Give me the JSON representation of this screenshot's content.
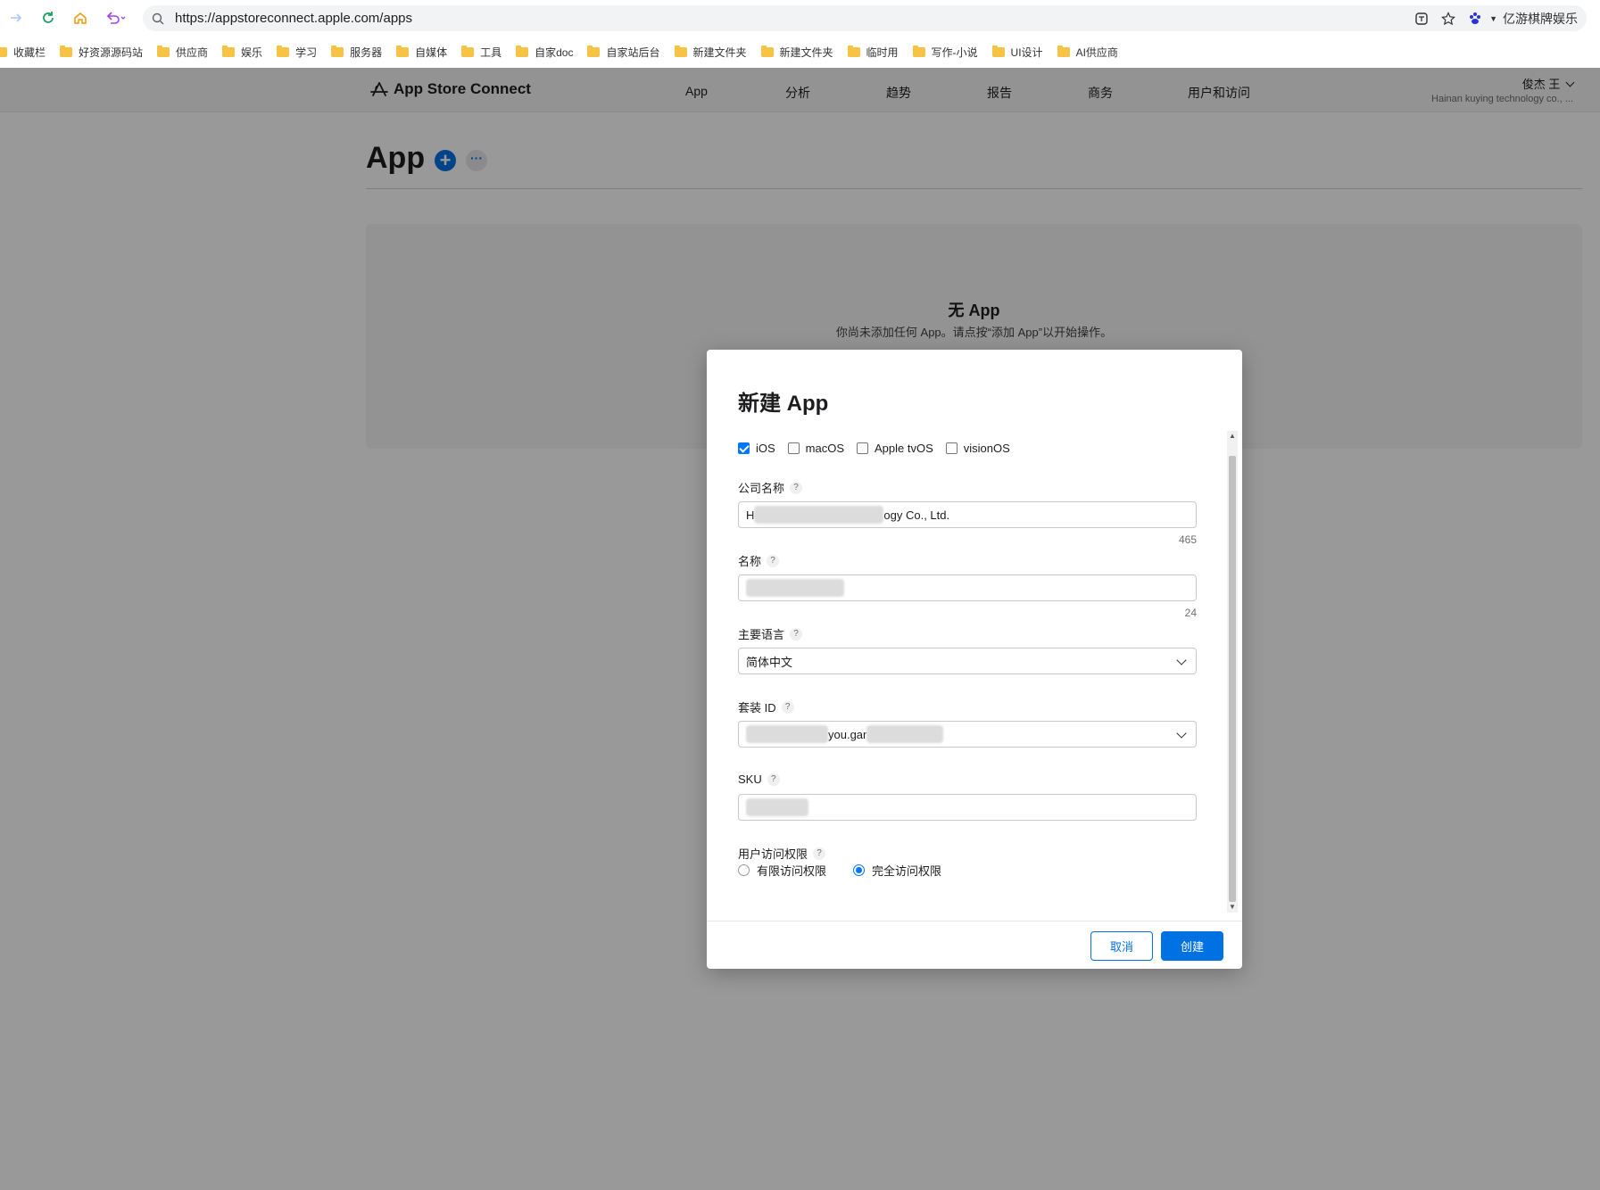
{
  "browser": {
    "url": "https://appstoreconnect.apple.com/apps",
    "profile_name": "亿游棋牌娱乐",
    "bookmarks": [
      "收藏栏",
      "好资源源码站",
      "供应商",
      "娱乐",
      "学习",
      "服务器",
      "自媒体",
      "工具",
      "自家doc",
      "自家站后台",
      "新建文件夹",
      "新建文件夹",
      "临时用",
      "写作-小说",
      "UI设计",
      "AI供应商"
    ]
  },
  "header": {
    "brand": "App Store Connect",
    "nav": [
      "App",
      "分析",
      "趋势",
      "报告",
      "商务",
      "用户和访问"
    ],
    "account_name": "俊杰 王",
    "account_org": "Hainan kuying technology co., ..."
  },
  "main": {
    "title": "App",
    "add_label": "+",
    "more_label": "···",
    "empty_title": "无 App",
    "empty_subtitle": "你尚未添加任何 App。请点按“添加 App”以开始操作。"
  },
  "modal": {
    "title": "新建 App",
    "platforms": [
      {
        "label": "iOS",
        "checked": true
      },
      {
        "label": "macOS",
        "checked": false
      },
      {
        "label": "Apple tvOS",
        "checked": false
      },
      {
        "label": "visionOS",
        "checked": false
      }
    ],
    "company_label": "公司名称",
    "company_value_prefix": "H",
    "company_value_suffix": "ogy Co., Ltd.",
    "company_count": "465",
    "name_label": "名称",
    "name_count": "24",
    "language_label": "主要语言",
    "language_value": "简体中文",
    "bundle_label": "套装 ID",
    "bundle_value_fragment": "you.gar",
    "sku_label": "SKU",
    "access_label": "用户访问权限",
    "access_options": [
      {
        "label": "有限访问权限",
        "selected": false
      },
      {
        "label": "完全访问权限",
        "selected": true
      }
    ],
    "help_mark": "?",
    "cancel_label": "取消",
    "create_label": "创建"
  },
  "icons": {
    "back": "arrow-right-icon",
    "reload": "reload-icon",
    "home": "home-icon",
    "undo": "undo-icon",
    "search": "search-icon",
    "translate": "translate-icon",
    "star": "star-icon",
    "paw": "paw-icon",
    "folder": "folder-icon",
    "appstore": "appstore-icon",
    "chevron": "chevron-down-icon"
  },
  "colors": {
    "accent": "#0071e3",
    "checkbox": "#0075ff",
    "folder": "#f6c344"
  }
}
